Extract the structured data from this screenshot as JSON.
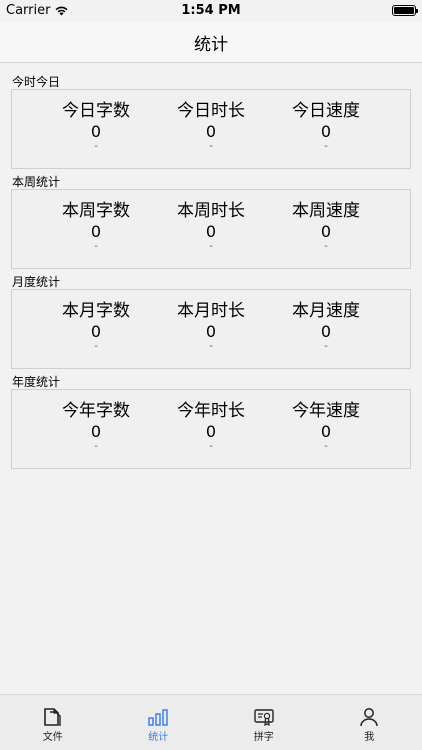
{
  "status_bar": {
    "carrier": "Carrier",
    "time": "1:54 PM"
  },
  "nav": {
    "title": "统计"
  },
  "sections": [
    {
      "title": "今时今日",
      "stats": [
        {
          "label": "今日字数",
          "value": "0",
          "sub": "-"
        },
        {
          "label": "今日时长",
          "value": "0",
          "sub": "-"
        },
        {
          "label": "今日速度",
          "value": "0",
          "sub": "-"
        }
      ]
    },
    {
      "title": "本周统计",
      "stats": [
        {
          "label": "本周字数",
          "value": "0",
          "sub": "-"
        },
        {
          "label": "本周时长",
          "value": "0",
          "sub": "-"
        },
        {
          "label": "本周速度",
          "value": "0",
          "sub": "-"
        }
      ]
    },
    {
      "title": "月度统计",
      "stats": [
        {
          "label": "本月字数",
          "value": "0",
          "sub": "-"
        },
        {
          "label": "本月时长",
          "value": "0",
          "sub": "-"
        },
        {
          "label": "本月速度",
          "value": "0",
          "sub": "-"
        }
      ]
    },
    {
      "title": "年度统计",
      "stats": [
        {
          "label": "今年字数",
          "value": "0",
          "sub": "-"
        },
        {
          "label": "今年时长",
          "value": "0",
          "sub": "-"
        },
        {
          "label": "今年速度",
          "value": "0",
          "sub": "-"
        }
      ]
    }
  ],
  "tabs": [
    {
      "label": "文件",
      "icon": "document-icon",
      "active": false
    },
    {
      "label": "统计",
      "icon": "bar-chart-icon",
      "active": true
    },
    {
      "label": "拼字",
      "icon": "certificate-icon",
      "active": false
    },
    {
      "label": "我",
      "icon": "person-icon",
      "active": false
    }
  ],
  "colors": {
    "accent": "#3478f6",
    "background": "#f2f2f2",
    "card_border": "#cfcfcf"
  }
}
